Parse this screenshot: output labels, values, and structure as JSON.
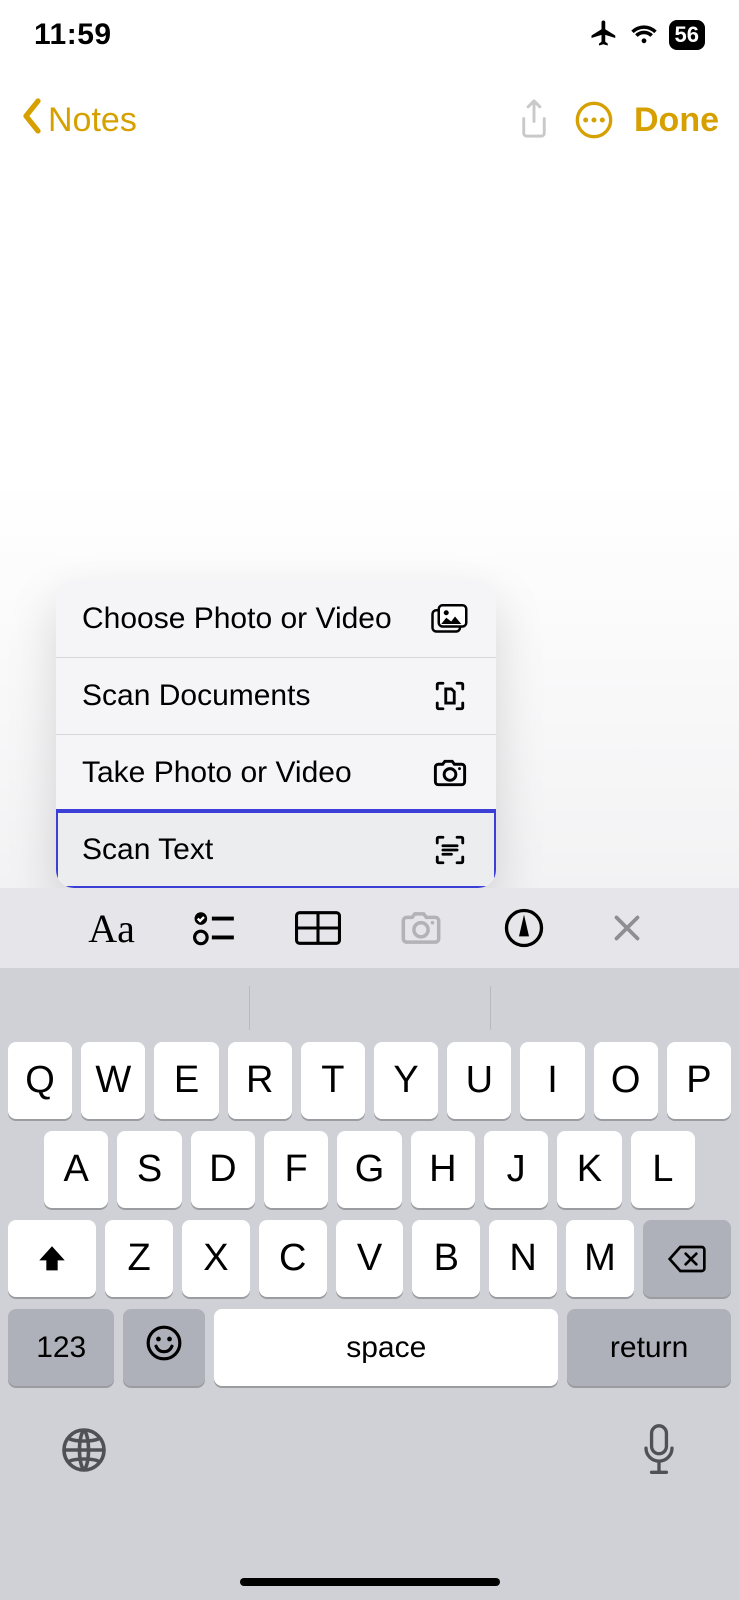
{
  "status": {
    "time": "11:59",
    "battery": "56"
  },
  "nav": {
    "back_label": "Notes",
    "done_label": "Done"
  },
  "menu": {
    "items": [
      {
        "label": "Choose Photo or Video",
        "icon": "photos-icon"
      },
      {
        "label": "Scan Documents",
        "icon": "scan-doc-icon"
      },
      {
        "label": "Take Photo or Video",
        "icon": "camera-icon"
      },
      {
        "label": "Scan Text",
        "icon": "scan-text-icon"
      }
    ],
    "highlighted_index": 3
  },
  "note_toolbar": {
    "format_label": "Aa"
  },
  "keyboard": {
    "row1": [
      "Q",
      "W",
      "E",
      "R",
      "T",
      "Y",
      "U",
      "I",
      "O",
      "P"
    ],
    "row2": [
      "A",
      "S",
      "D",
      "F",
      "G",
      "H",
      "J",
      "K",
      "L"
    ],
    "row3": [
      "Z",
      "X",
      "C",
      "V",
      "B",
      "N",
      "M"
    ],
    "numbers_label": "123",
    "space_label": "space",
    "return_label": "return"
  }
}
